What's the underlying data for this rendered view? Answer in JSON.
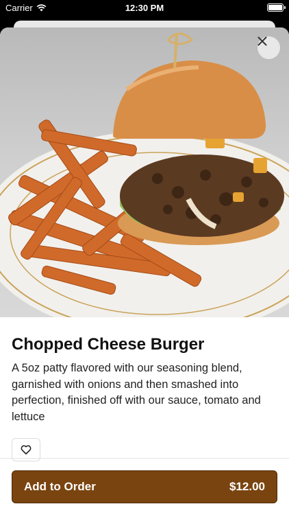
{
  "status_bar": {
    "carrier": "Carrier",
    "time": "12:30 PM"
  },
  "item": {
    "title": "Chopped Cheese Burger",
    "description": "A 5oz patty flavored with our seasoning blend, garnished with onions and then smashed into perfection, finished off with our sauce, tomato and lettuce"
  },
  "order_button": {
    "label": "Add to Order",
    "price": "$12.00"
  },
  "icons": {
    "close": "close-icon",
    "favorite": "heart-icon",
    "wifi": "wifi-icon",
    "battery": "battery-icon"
  },
  "colors": {
    "accent": "#7a4410"
  }
}
